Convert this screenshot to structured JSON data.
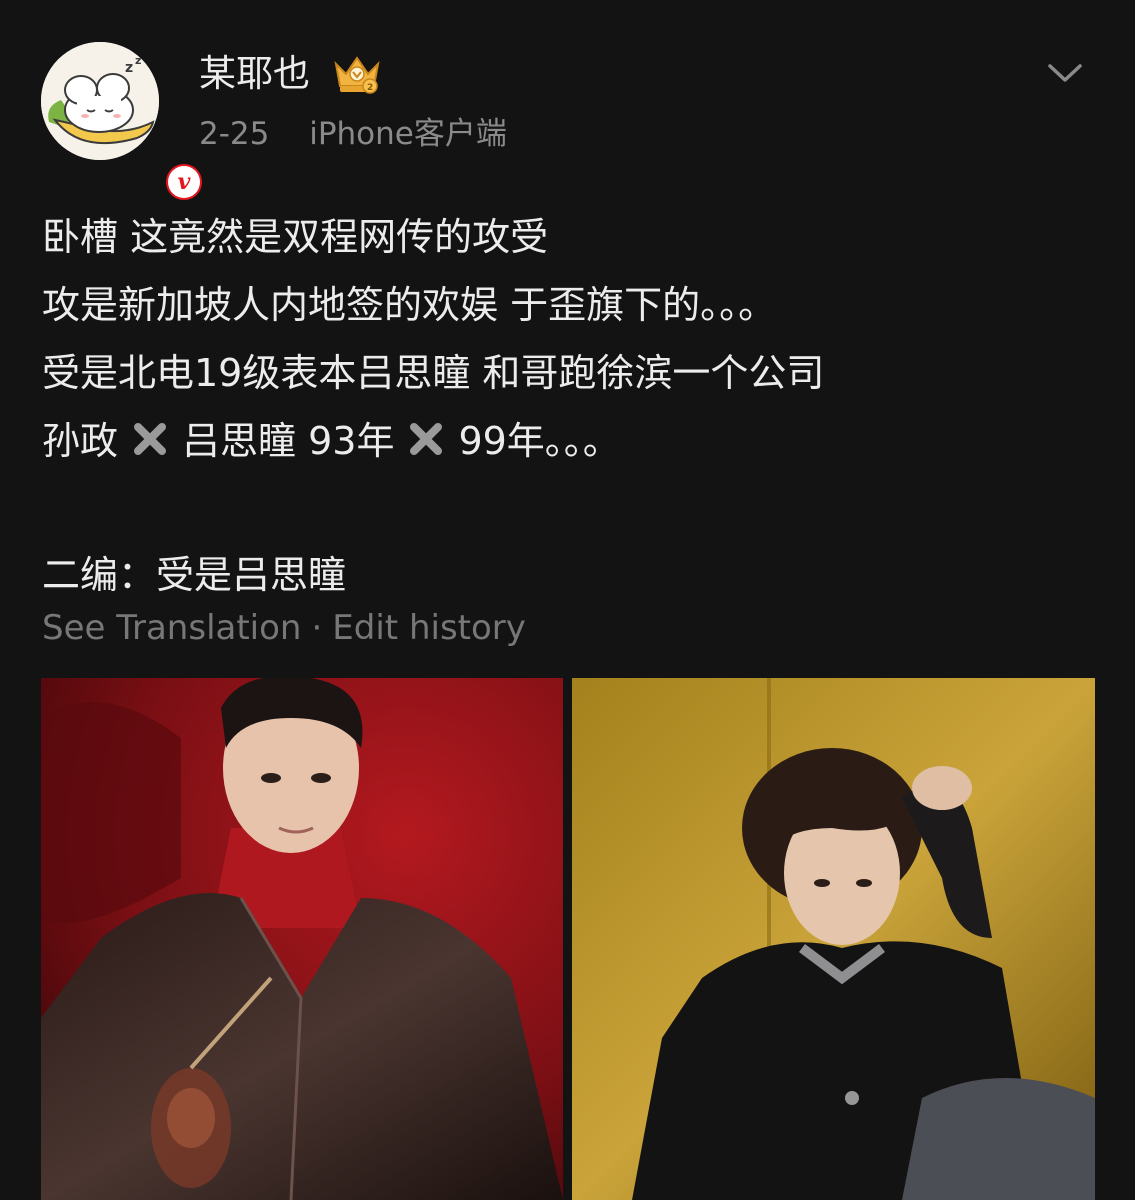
{
  "post": {
    "author": {
      "name": "某耶也",
      "avatar_icon": "sleeping-bunny-avatar",
      "verified_badge": "v",
      "vip_icon": "vip-crown-icon"
    },
    "date": "2-25",
    "source": "iPhone客户端",
    "menu_icon": "chevron-down-icon",
    "lines": [
      {
        "text": "卧槽 这竟然是双程网传的攻受"
      },
      {
        "text": "攻是新加坡人内地签的欢娱 于歪旗下的。。。"
      },
      {
        "text": "受是北电19级表本吕思瞳 和哥跑徐滨一个公司"
      },
      {
        "parts": [
          "孙政",
          "吕思瞳 93年",
          "99年。。。"
        ]
      },
      {
        "text": "二编：受是吕思瞳"
      }
    ],
    "see_translation": "See Translation",
    "separator": "·",
    "edit_history": "Edit history",
    "photos": [
      {
        "name": "photo-man-red-background",
        "accent": "#8e1418"
      },
      {
        "name": "photo-man-yellow-background",
        "accent": "#b08a1e"
      }
    ],
    "colors": {
      "background": "#131313",
      "text": "#ececec",
      "muted": "#8a8a8a",
      "badge_red": "#e6161f"
    }
  }
}
